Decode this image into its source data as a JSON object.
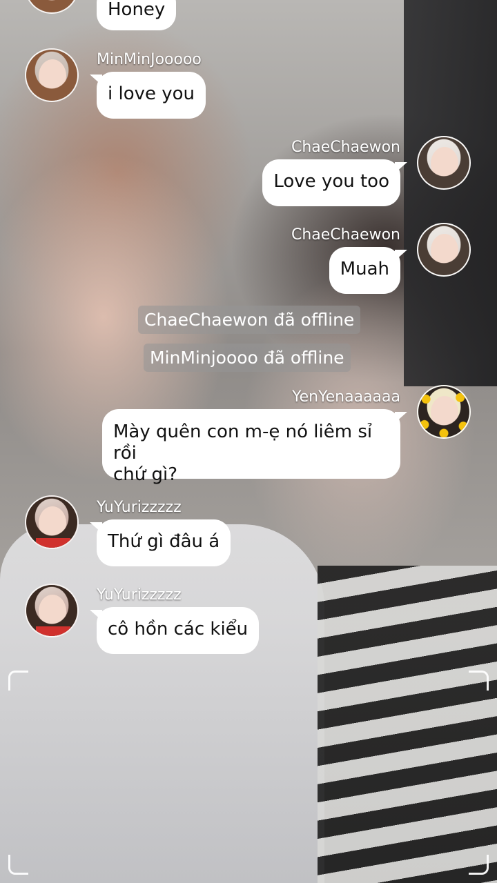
{
  "messages": [
    {
      "sender": "",
      "text": "Honey",
      "side": "left",
      "avatar": "minmin-avatar"
    },
    {
      "sender": "MinMinJooooo",
      "text": "i love you",
      "side": "left",
      "avatar": "minmin-avatar"
    },
    {
      "sender": "ChaeChaewon",
      "text": "Love you too",
      "side": "right",
      "avatar": "chae-avatar"
    },
    {
      "sender": "ChaeChaewon",
      "text": "Muah",
      "side": "right",
      "avatar": "chae-avatar"
    },
    {
      "sender": "YenYenaaaaaa",
      "text": "Mày quên con m-ẹ nó liêm sỉ rồi chứ gì?",
      "text_line1": "Mày quên con m-ẹ nó liêm sỉ rồi",
      "text_line2": "chứ gì?",
      "side": "right",
      "avatar": "yen-avatar"
    },
    {
      "sender": "YuYurizzzzz",
      "text": "Thứ gì đâu á",
      "side": "left",
      "avatar": "yuri-avatar"
    },
    {
      "sender": "YuYurizzzzz",
      "text": "cô hồn các kiểu",
      "side": "left",
      "avatar": "yuri-avatar"
    }
  ],
  "system_notices": [
    "ChaeChaewon đã offline",
    "MinMinjoooo đã offline"
  ],
  "colors": {
    "bubble_bg": "#ffffff",
    "bubble_text": "#111111",
    "name_text": "#ffffff",
    "notice_bg": "#969696"
  }
}
